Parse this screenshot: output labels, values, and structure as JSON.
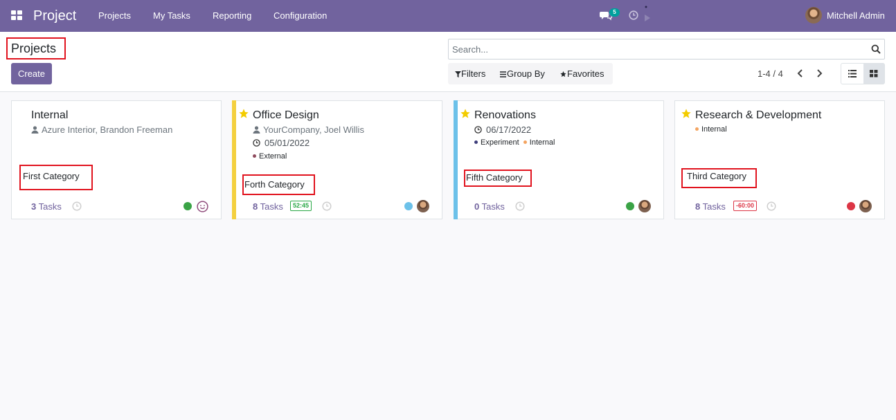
{
  "navbar": {
    "app_title": "Project",
    "menu": [
      "Projects",
      "My Tasks",
      "Reporting",
      "Configuration"
    ],
    "chat_count": "5",
    "user_name": "Mitchell Admin",
    "color": "#71639e"
  },
  "control_panel": {
    "breadcrumb": "Projects",
    "create_label": "Create",
    "search_placeholder": "Search...",
    "filters_label": "Filters",
    "groupby_label": "Group By",
    "favorites_label": "Favorites",
    "pager": "1-4 / 4"
  },
  "cards": [
    {
      "title": "Internal",
      "favorite": false,
      "color": "",
      "customer": "Azure Interior, Brandon Freeman",
      "date": "",
      "tags": [],
      "category": "First Category",
      "task_count": "3",
      "tasks_label": "Tasks",
      "time_badge": "",
      "status_color": "#3aa346",
      "avatar": "smiley"
    },
    {
      "title": "Office Design",
      "favorite": true,
      "color": "#f4d03f",
      "customer": "YourCompany, Joel Willis",
      "date": "05/01/2022",
      "tags": [
        {
          "name": "External",
          "color": "#8e4a5c"
        }
      ],
      "category": "Forth Category",
      "task_count": "8",
      "tasks_label": "Tasks",
      "time_badge": "52:45",
      "time_badge_color": "#28a745",
      "status_color": "#6cc1e9",
      "avatar": "user"
    },
    {
      "title": "Renovations",
      "favorite": true,
      "color": "#6cc1e9",
      "customer": "",
      "date": "06/17/2022",
      "tags": [
        {
          "name": "Experiment",
          "color": "#3d3d7a"
        },
        {
          "name": "Internal",
          "color": "#f4a460"
        }
      ],
      "category": "Fifth Category",
      "task_count": "0",
      "tasks_label": "Tasks",
      "time_badge": "",
      "status_color": "#3aa346",
      "avatar": "user"
    },
    {
      "title": "Research & Development",
      "favorite": true,
      "color": "",
      "customer": "",
      "date": "",
      "tags": [
        {
          "name": "Internal",
          "color": "#f4a460"
        }
      ],
      "category": "Third Category",
      "task_count": "8",
      "tasks_label": "Tasks",
      "time_badge": "-60:00",
      "time_badge_color": "#dc3545",
      "status_color": "#dc3545",
      "avatar": "user"
    }
  ]
}
